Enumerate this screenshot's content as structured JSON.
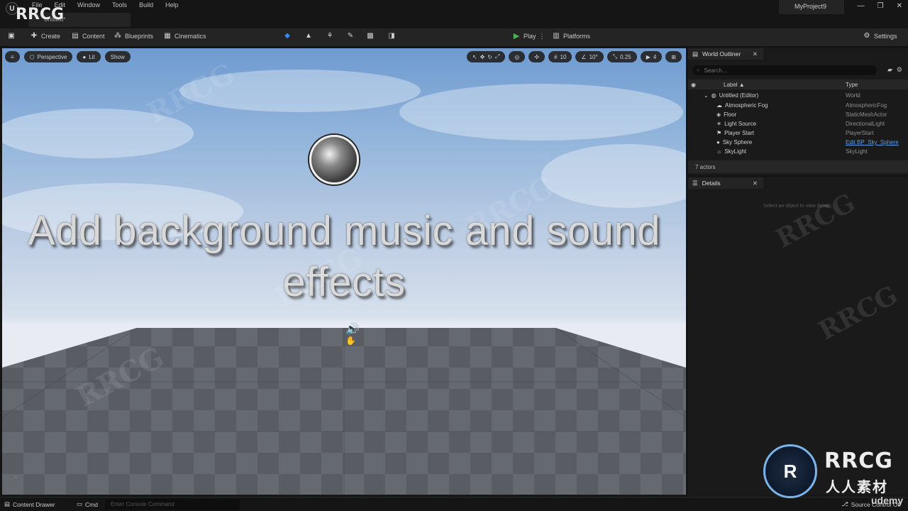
{
  "app": {
    "menus": [
      "File",
      "Edit",
      "Window",
      "Tools",
      "Build",
      "Help"
    ],
    "level_tab": "Untitled*",
    "project_name": "MyProject9"
  },
  "toolbar": {
    "save_label": "",
    "create_label": "Create",
    "content_label": "Content",
    "blueprints_label": "Blueprints",
    "cinematics_label": "Cinematics",
    "play_label": "Play",
    "platforms_label": "Platforms",
    "settings_label": "Settings"
  },
  "viewport": {
    "perspective_label": "Perspective",
    "lit_label": "Lit",
    "show_label": "Show",
    "grid_snap": "10",
    "rotation_snap": "10°",
    "scale_snap": "0.25",
    "camera_speed": "4",
    "caption_line1": "Add background music and sound",
    "caption_line2": "effects"
  },
  "outliner": {
    "tab_label": "World Outliner",
    "search_placeholder": "Search...",
    "col_label": "Label",
    "col_type": "Type",
    "rows": [
      {
        "name": "Untitled (Editor)",
        "type": "World",
        "icon": "world-icon"
      },
      {
        "name": "Atmospheric Fog",
        "type": "AtmosphericFog",
        "icon": "fog-icon"
      },
      {
        "name": "Floor",
        "type": "StaticMeshActor",
        "icon": "mesh-icon"
      },
      {
        "name": "Light Source",
        "type": "DirectionalLight",
        "icon": "light-icon"
      },
      {
        "name": "Player Start",
        "type": "PlayerStart",
        "icon": "player-start-icon"
      },
      {
        "name": "Sky Sphere",
        "type": "Edit BP_Sky_Sphere",
        "icon": "sphere-icon"
      },
      {
        "name": "SkyLight",
        "type": "SkyLight",
        "icon": "skylight-icon"
      }
    ],
    "actor_count": "7 actors"
  },
  "details": {
    "tab_label": "Details",
    "empty_text": "Select an object to view details."
  },
  "bottom": {
    "content_drawer_label": "Content Drawer",
    "cmd_label": "Cmd",
    "console_placeholder": "Enter Console Command",
    "source_control_label": "Source Control Off"
  },
  "watermark": {
    "top_left": "RRCG",
    "brand": "RRCG",
    "brand_cn": "人人素材",
    "udemy": "udemy"
  },
  "colors": {
    "accent_blue": "#2f8cf0",
    "play_green": "#4caf50",
    "panel_bg": "#1a1a1a",
    "toolbar_bg": "#242424"
  }
}
